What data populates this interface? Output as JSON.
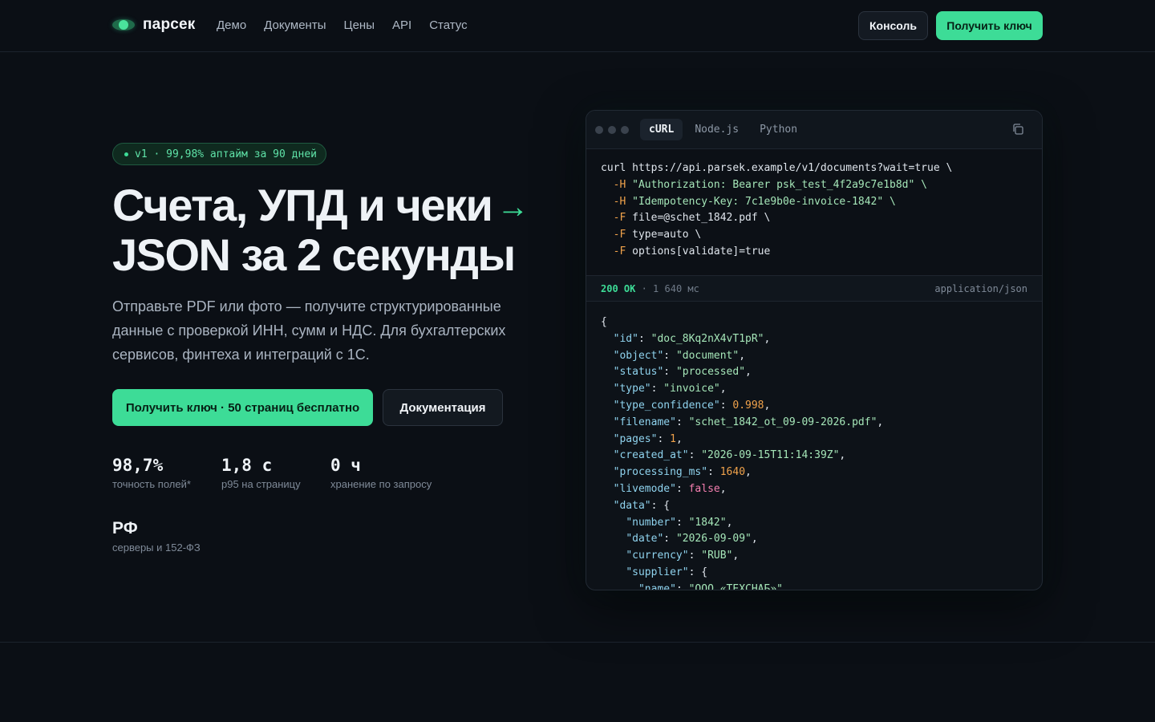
{
  "nav": {
    "brand": "парсек",
    "links": [
      "Демо",
      "Документы",
      "Цены",
      "API",
      "Статус"
    ],
    "console_label": "Консоль",
    "get_key_label": "Получить ключ"
  },
  "hero": {
    "badge": "v1 · 99,98% аптайм за 90 дней",
    "title_line1": "Счета, УПД и чеки",
    "title_arrow": "→",
    "title_line2": "JSON за 2 секунды",
    "subtitle": "Отправьте PDF или фото — получите структурированные данные с проверкой ИНН, сумм и НДС. Для бухгалтерских сервисов, финтеха и интеграций с 1С.",
    "primary_cta": "Получить ключ · 50 страниц бесплатно",
    "secondary_cta": "Документация",
    "stats": [
      {
        "value": "98,7%",
        "label": "точность полей*"
      },
      {
        "value": "1,8 с",
        "label": "p95 на страницу"
      },
      {
        "value": "0 ч",
        "label": "хранение по запросу"
      },
      {
        "value": "РФ",
        "label": "серверы и 152-ФЗ"
      }
    ]
  },
  "code": {
    "tabs": [
      "cURL",
      "Node.js",
      "Python"
    ],
    "active_tab": "cURL",
    "request": {
      "url_line": "curl https://api.parsek.example/v1/documents?wait=true \\",
      "h1": "\"Authorization: Bearer psk_test_4f2a9c7e1b8d\" \\",
      "h2": "\"Idempotency-Key: 7c1e9b0e-invoice-1842\" \\",
      "f1": "file=@schet_1842.pdf \\",
      "f2": "type=auto \\",
      "f3": "options[validate]=true",
      "flag_h": "-H",
      "flag_f": "-F"
    },
    "status": {
      "code": "200 OK",
      "time": "· 1 640 мс",
      "content_type": "application/json"
    },
    "response": {
      "id": "\"doc_8Kq2nX4vT1pR\"",
      "object": "\"document\"",
      "status": "\"processed\"",
      "type": "\"invoice\"",
      "type_confidence": "0.998",
      "filename": "\"schet_1842_ot_09-09-2026.pdf\"",
      "pages": "1",
      "created_at": "\"2026-09-15T11:14:39Z\"",
      "processing_ms": "1640",
      "livemode": "false",
      "number": "\"1842\"",
      "date": "\"2026-09-09\"",
      "currency": "\"RUB\"",
      "supplier_name": "\"ООО «ТЕХСНАБ»\""
    }
  }
}
